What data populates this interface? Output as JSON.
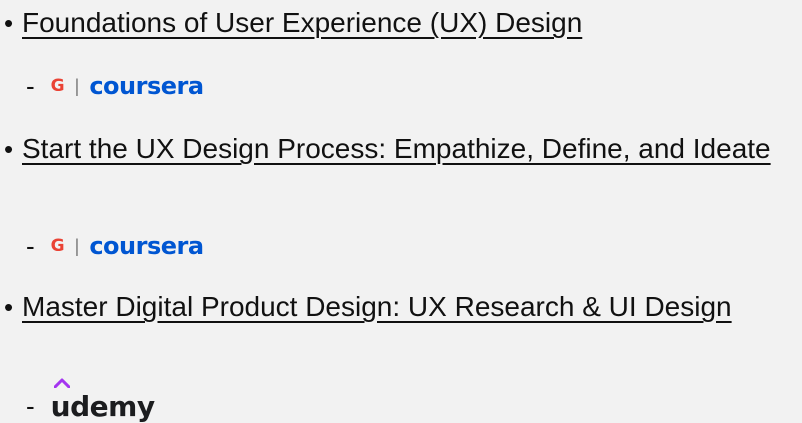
{
  "courses": [
    {
      "title": "Foundations of User Experience (UX) Design",
      "provider": "coursera",
      "partner_mark": "G",
      "separator": "|"
    },
    {
      "title": "Start the UX Design Process: Empathize, Define, and Ideate",
      "provider": "coursera",
      "partner_mark": "G",
      "separator": "|"
    },
    {
      "title": "Master Digital Product Design: UX Research & UI Design",
      "provider": "udemy"
    }
  ],
  "bullet": "•",
  "dash": "-",
  "colors": {
    "background": "#f2f2f2",
    "text": "#111111",
    "coursera_blue": "#0056d2",
    "google_g": "#ea4335",
    "udemy_purple": "#a435f0",
    "udemy_text": "#1c1d1f"
  },
  "icons": {
    "google": "google-g-icon",
    "udemy_hat": "udemy-hat-icon"
  }
}
